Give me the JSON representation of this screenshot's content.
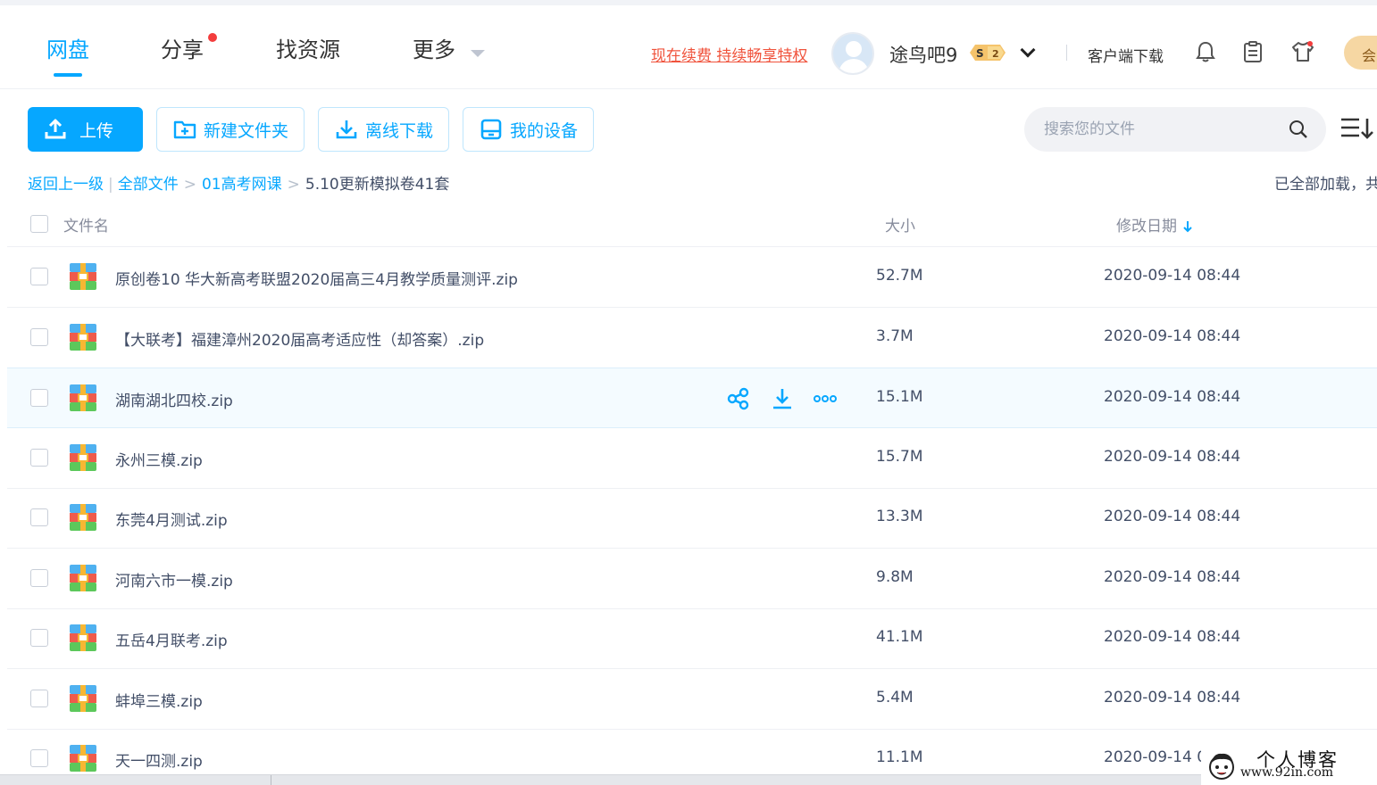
{
  "nav": {
    "items": [
      {
        "label": "网盘",
        "active": true
      },
      {
        "label": "分享",
        "has_dot": true
      },
      {
        "label": "找资源"
      },
      {
        "label": "更多"
      }
    ]
  },
  "header": {
    "renew_link": "现在续费 持续畅享特权",
    "username": "途鸟吧9",
    "badge_s": "S",
    "badge_level": "2",
    "client_download": "客户端下载",
    "vip_label": "会"
  },
  "toolbar": {
    "upload": "上传",
    "new_folder": "新建文件夹",
    "offline_download": "离线下载",
    "my_devices": "我的设备",
    "search_placeholder": "搜索您的文件"
  },
  "breadcrumb": {
    "back": "返回上一级",
    "all_files": "全部文件",
    "folder": "01高考网课",
    "current": "5.10更新模拟卷41套",
    "loaded_status": "已全部加载，共"
  },
  "table": {
    "headers": {
      "name": "文件名",
      "size": "大小",
      "date": "修改日期"
    },
    "rows": [
      {
        "name": "原创卷10 华大新高考联盟2020届高三4月教学质量测评.zip",
        "size": "52.7M",
        "date": "2020-09-14 08:44"
      },
      {
        "name": "【大联考】福建漳州2020届高考适应性（却答案）.zip",
        "size": "3.7M",
        "date": "2020-09-14 08:44"
      },
      {
        "name": "湖南湖北四校.zip",
        "size": "15.1M",
        "date": "2020-09-14 08:44",
        "hover": true
      },
      {
        "name": "永州三模.zip",
        "size": "15.7M",
        "date": "2020-09-14 08:44"
      },
      {
        "name": "东莞4月测试.zip",
        "size": "13.3M",
        "date": "2020-09-14 08:44"
      },
      {
        "name": "河南六市一模.zip",
        "size": "9.8M",
        "date": "2020-09-14 08:44"
      },
      {
        "name": "五岳4月联考.zip",
        "size": "41.1M",
        "date": "2020-09-14 08:44"
      },
      {
        "name": "蚌埠三模.zip",
        "size": "5.4M",
        "date": "2020-09-14 08:44"
      },
      {
        "name": "天一四测.zip",
        "size": "11.1M",
        "date": "2020-09-14 0"
      }
    ]
  },
  "watermark": {
    "title": "个人博客",
    "url": "www.92in.com"
  },
  "colors": {
    "accent": "#06a7ff",
    "renew": "#f0533c",
    "text": "#424e67"
  }
}
